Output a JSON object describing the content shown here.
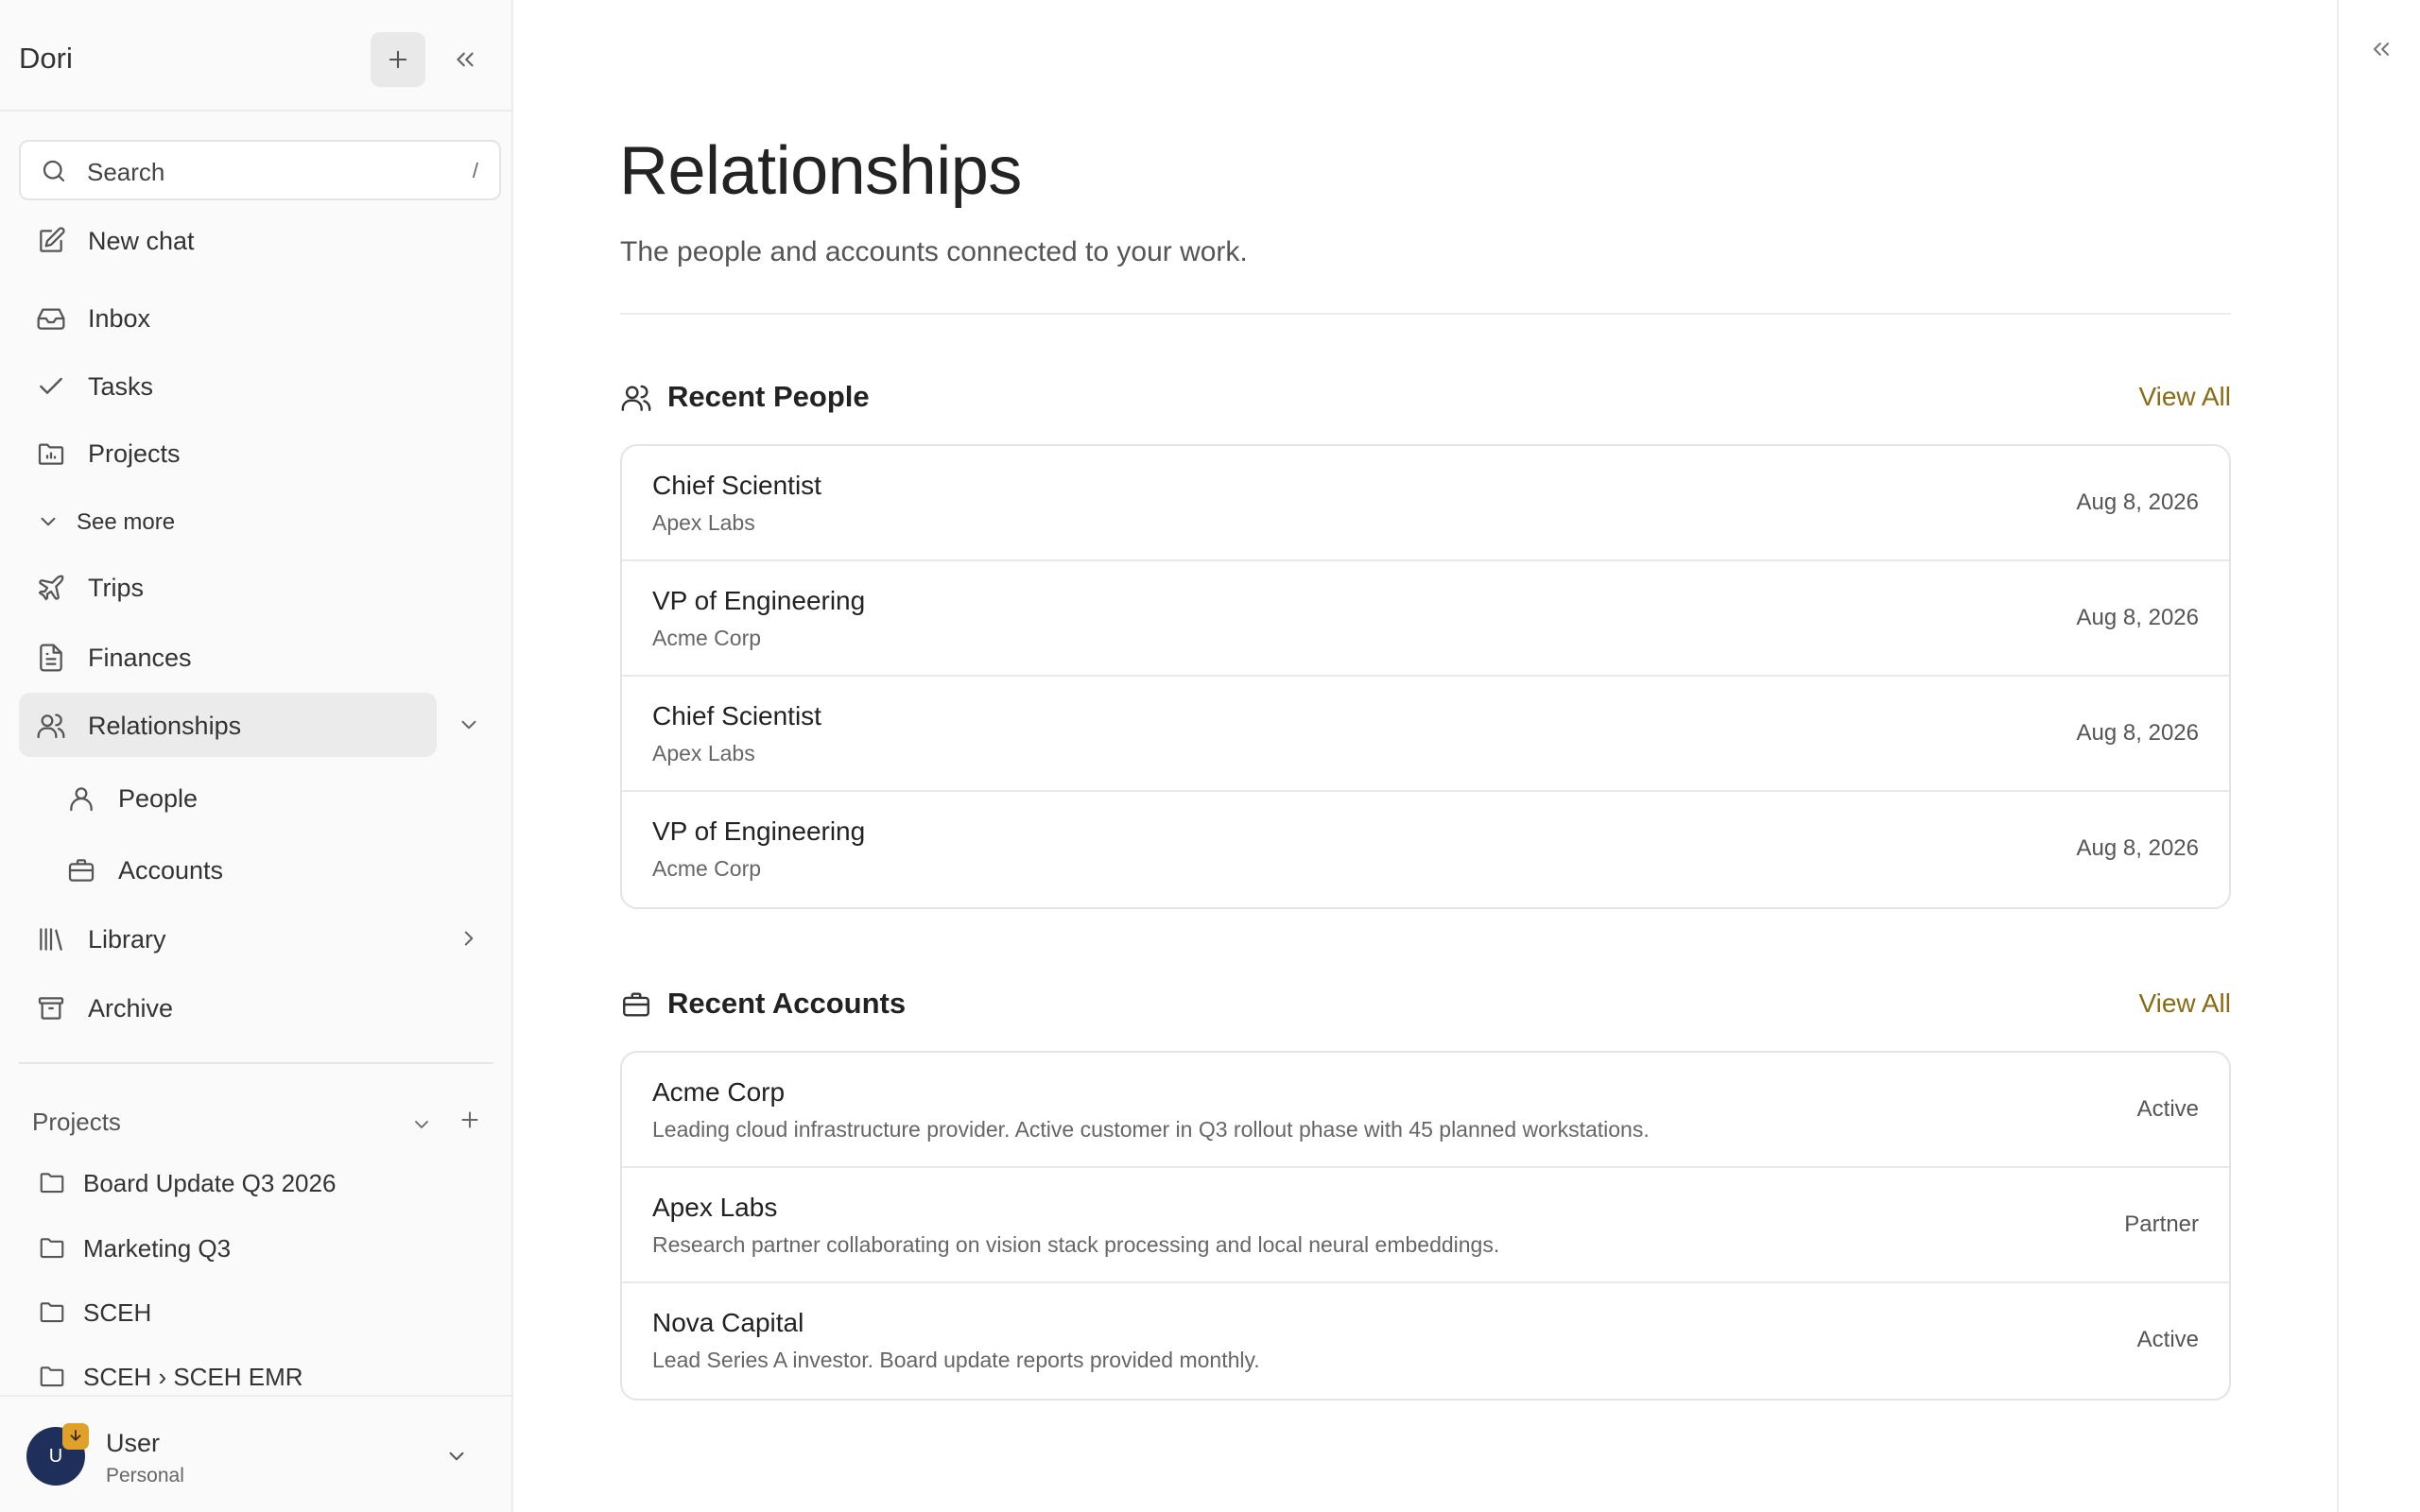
{
  "app": {
    "title": "Dori"
  },
  "search": {
    "label": "Search",
    "shortcut": "/"
  },
  "nav": {
    "new_chat": "New chat",
    "inbox": "Inbox",
    "tasks": "Tasks",
    "projects": "Projects",
    "see_more": "See more",
    "trips": "Trips",
    "finances": "Finances",
    "relationships": "Relationships",
    "people": "People",
    "accounts": "Accounts",
    "library": "Library",
    "archive": "Archive"
  },
  "projects_section": {
    "title": "Projects",
    "items": [
      "Board Update Q3 2026",
      "Marketing Q3",
      "SCEH",
      "SCEH › SCEH EMR"
    ]
  },
  "user": {
    "initial": "U",
    "name": "User",
    "plan": "Personal"
  },
  "page": {
    "title": "Relationships",
    "subtitle": "The people and accounts connected to your work."
  },
  "recent_people": {
    "title": "Recent People",
    "view_all": "View All",
    "rows": [
      {
        "title": "Chief Scientist",
        "subtitle": "Apex Labs",
        "date": "Aug 8, 2026"
      },
      {
        "title": "VP of Engineering",
        "subtitle": "Acme Corp",
        "date": "Aug 8, 2026"
      },
      {
        "title": "Chief Scientist",
        "subtitle": "Apex Labs",
        "date": "Aug 8, 2026"
      },
      {
        "title": "VP of Engineering",
        "subtitle": "Acme Corp",
        "date": "Aug 8, 2026"
      }
    ]
  },
  "recent_accounts": {
    "title": "Recent Accounts",
    "view_all": "View All",
    "rows": [
      {
        "title": "Acme Corp",
        "subtitle": "Leading cloud infrastructure provider. Active customer in Q3 rollout phase with 45 planned workstations.",
        "status": "Active"
      },
      {
        "title": "Apex Labs",
        "subtitle": "Research partner collaborating on vision stack processing and local neural embeddings.",
        "status": "Partner"
      },
      {
        "title": "Nova Capital",
        "subtitle": "Lead Series A investor. Board update reports provided monthly.",
        "status": "Active"
      }
    ]
  },
  "colors": {
    "accent": "#8a6a12",
    "active_nav": "#ebebeb",
    "avatar": "#1f2f5c",
    "badge": "#e0a12a"
  }
}
